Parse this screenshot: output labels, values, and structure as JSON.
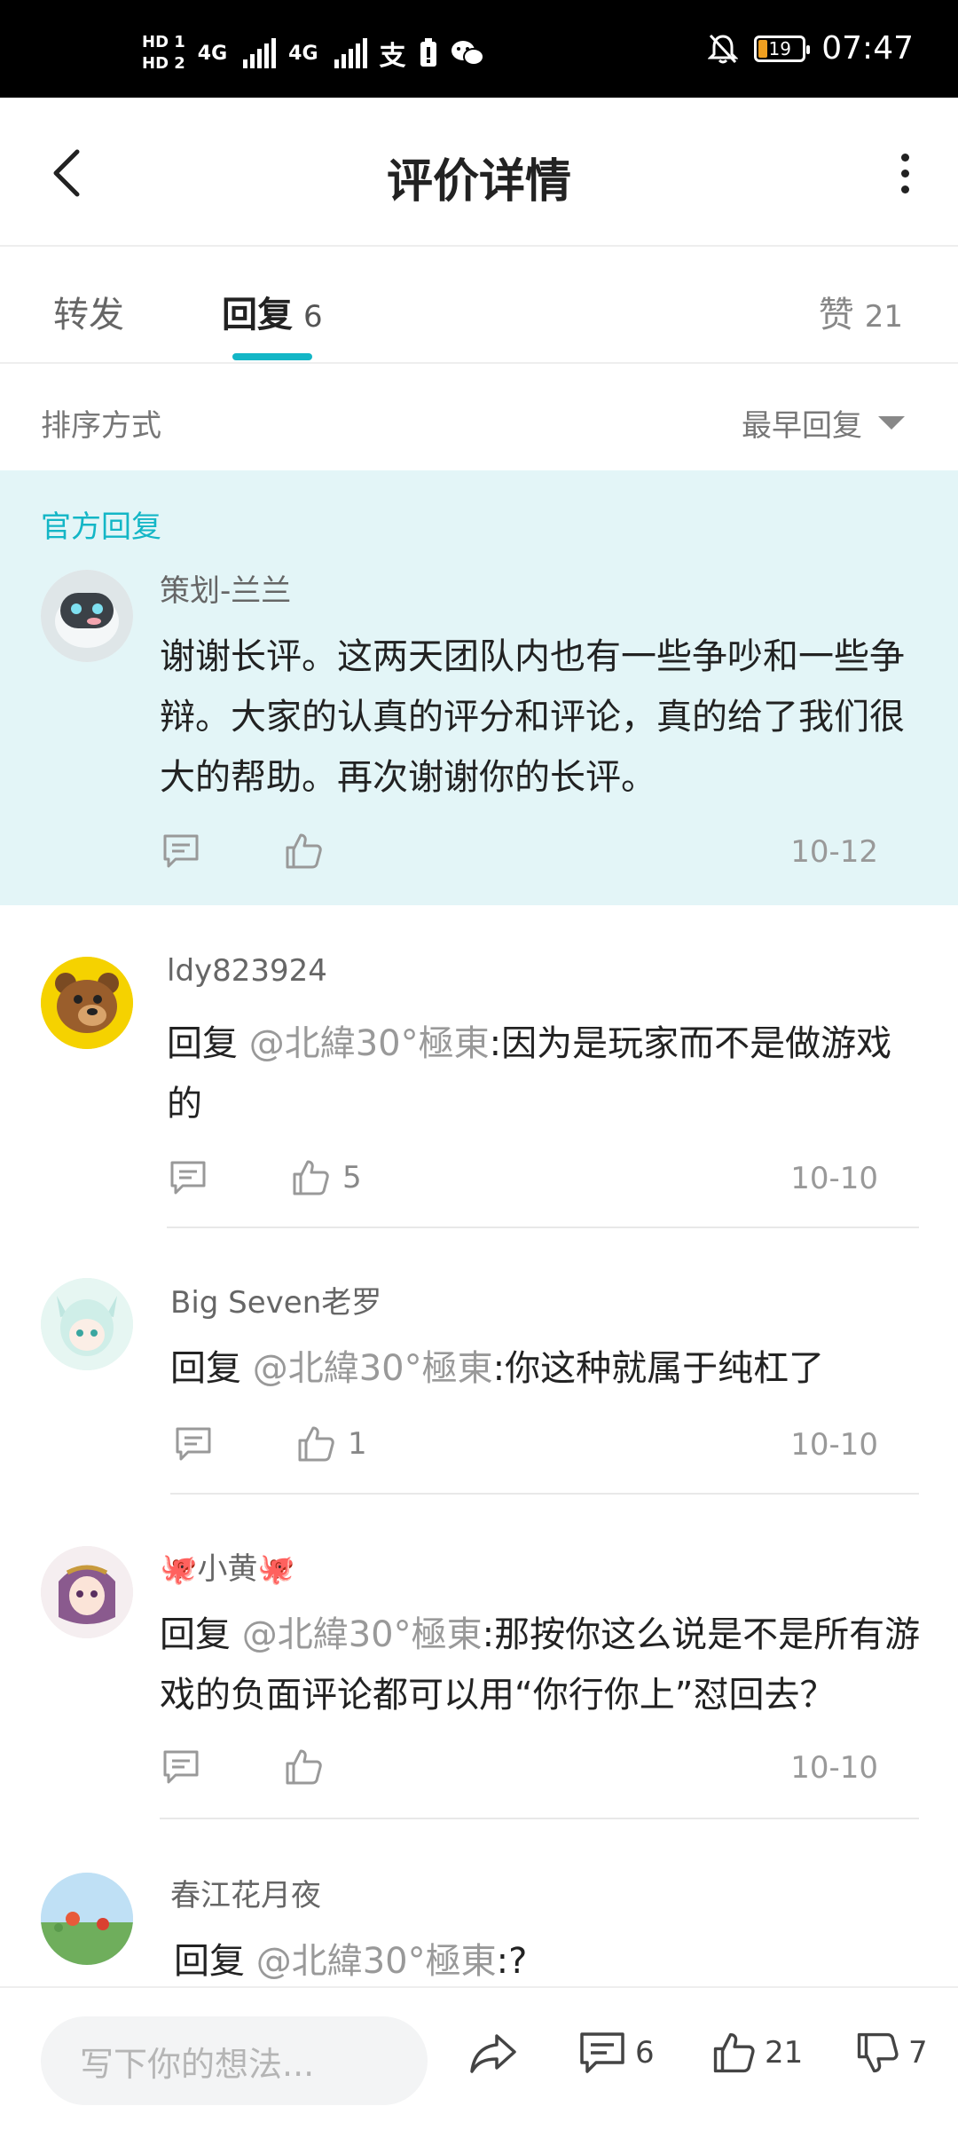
{
  "status_bar": {
    "hd1": "HD 1",
    "hd2": "HD 2",
    "net1": "4G",
    "net2": "4G",
    "battery": "19",
    "time": "07:47"
  },
  "header": {
    "title": "评价详情"
  },
  "tabs": {
    "forward_label": "转发",
    "reply_label": "回复",
    "reply_count": "6",
    "like_label": "赞",
    "like_count": "21"
  },
  "sort": {
    "label": "排序方式",
    "value": "最早回复"
  },
  "official": {
    "section_label": "官方回复",
    "author": "策划-兰兰",
    "text": "谢谢长评。这两天团队内也有一些争吵和一些争辩。大家的认真的评分和评论，真的给了我们很大的帮助。再次谢谢你的长评。",
    "date": "10-12"
  },
  "replies": [
    {
      "author": "ldy823924",
      "prefix": "回复 ",
      "mention": "@北緯30°極東",
      "text": ":因为是玩家而不是做游戏的",
      "likes": "5",
      "date": "10-10"
    },
    {
      "author": "Big Seven老罗",
      "prefix": "回复 ",
      "mention": "@北緯30°極東",
      "text": ":你这种就属于纯杠了",
      "likes": "1",
      "date": "10-10"
    },
    {
      "author": "🐙小黄🐙",
      "prefix": "回复 ",
      "mention": "@北緯30°極東",
      "text": ":那按你这么说是不是所有游戏的负面评论都可以用“你行你上”怼回去？",
      "likes": "",
      "date": "10-10"
    },
    {
      "author": "春江花月夜",
      "prefix": "回复 ",
      "mention": "@北緯30°極東",
      "text": ":?",
      "likes": "",
      "date": ""
    }
  ],
  "bottom_bar": {
    "placeholder": "写下你的想法...",
    "comment_count": "6",
    "like_count": "21",
    "dislike_count": "7"
  },
  "colors": {
    "accent": "#13b6c6",
    "official_bg": "#e3f5f7",
    "divider": "#e8e8e8"
  },
  "icons": [
    "back-arrow-icon",
    "more-vertical-icon",
    "dropdown-triangle-icon",
    "comment-icon",
    "thumbs-up-icon",
    "share-icon",
    "thumbs-down-icon",
    "signal-icon",
    "alipay-icon",
    "wechat-icon",
    "mute-icon",
    "battery-icon"
  ]
}
